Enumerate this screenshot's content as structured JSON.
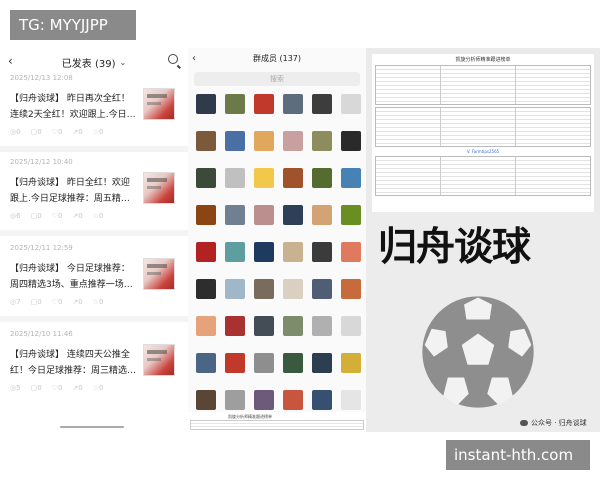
{
  "watermarks": {
    "top_left": "TG: MYYJJPP",
    "bottom_right": "instant-hth.com"
  },
  "left_panel": {
    "header": {
      "title": "已发表 (39)"
    },
    "posts": [
      {
        "date": "2025/12/13 12:08",
        "text": "【归舟谈球】 昨日再次全红！连续2天全红！欢迎跟上.今日…",
        "stats": [
          "0",
          "0",
          "0",
          "0",
          "0"
        ]
      },
      {
        "date": "2025/12/12 10:40",
        "text": "【归舟谈球】 昨日全红！欢迎跟上.今日足球推荐：周五精…",
        "stats": [
          "6",
          "0",
          "0",
          "0",
          "0"
        ]
      },
      {
        "date": "2025/12/11 12:59",
        "text": "【归舟谈球】 今日足球推荐：周四精选3场、重点推荐一场…",
        "stats": [
          "7",
          "0",
          "0",
          "0",
          "0"
        ]
      },
      {
        "date": "2025/12/10 11:46",
        "text": "【归舟谈球】 连续四天公推全红！今日足球推荐：周三精选…",
        "stats": [
          "5",
          "0",
          "0",
          "0",
          "0"
        ]
      }
    ]
  },
  "middle_panel": {
    "header": {
      "title": "群成员 (137)"
    },
    "search_placeholder": "搜索",
    "avatar_colors": [
      "#2f3b4a",
      "#6c7a4a",
      "#c0392b",
      "#5d6d7e",
      "#3d3d3d",
      "#d8d8d8",
      "#7b5a3c",
      "#4a6fa5",
      "#e0a85c",
      "#c9a0a0",
      "#8c8c5c",
      "#2a2a2a",
      "#3c4a3a",
      "#c0c0c0",
      "#f2c84b",
      "#a0522d",
      "#556b2f",
      "#4682b4",
      "#8b4513",
      "#708090",
      "#bc8f8f",
      "#2e4057",
      "#d4a373",
      "#6b8e23",
      "#b22222",
      "#5f9ea0",
      "#1f3a5f",
      "#c9b28f",
      "#3b3b3b",
      "#e07a5f",
      "#2d2d2d",
      "#9fb7c9",
      "#7a6c5d",
      "#d9d0c1",
      "#4f5d75",
      "#c86b3c",
      "#e6a27a",
      "#a83232",
      "#444c56",
      "#7d8c6a",
      "#b0b0b0",
      "#d8d8d8",
      "#4b6584",
      "#c0392b",
      "#8e8e8e",
      "#3a5a40",
      "#2c3e50",
      "#d4af37",
      "#5b4636",
      "#9e9e9e",
      "#6d597a",
      "#c8553d",
      "#355070",
      "#e5e5e5",
      "#f4a261",
      "#264653",
      "#8d99ae",
      "#2b2d42",
      "#b56576",
      "#a3b18a"
    ],
    "bottom_caption": "凯旋分析师精准跟进榜单"
  },
  "right_panel": {
    "table_title": "凯旋分析师精准跟进榜单",
    "table_note": "V: Farmtips2565",
    "poster_title": "归舟谈球",
    "wechat_label": "公众号 · 归舟谈球"
  }
}
